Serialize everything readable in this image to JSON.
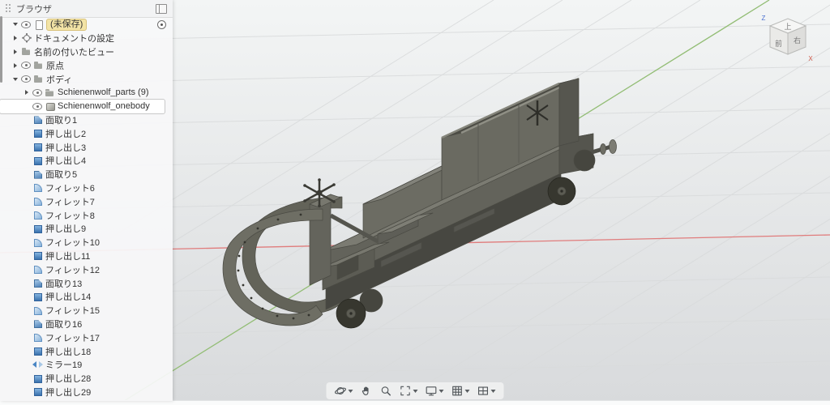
{
  "browser": {
    "title": "ブラウザ",
    "items": [
      {
        "label": "(未保存)",
        "icon": "document",
        "arrow": "open",
        "eye": true,
        "indent": 0,
        "pill": true,
        "radio": true
      },
      {
        "label": "ドキュメントの設定",
        "icon": "gear",
        "arrow": "closed",
        "eye": false,
        "indent": 0
      },
      {
        "label": "名前の付いたビュー",
        "icon": "folder",
        "arrow": "closed",
        "eye": false,
        "indent": 0
      },
      {
        "label": "原点",
        "icon": "folder",
        "arrow": "closed",
        "eye": true,
        "indent": 0
      },
      {
        "label": "ボディ",
        "icon": "folder",
        "arrow": "open",
        "eye": true,
        "indent": 0
      },
      {
        "label": "Schienenwolf_parts (9)",
        "icon": "folder",
        "arrow": "closed",
        "eye": true,
        "indent": 1
      },
      {
        "label": "Schienenwolf_onebody",
        "icon": "body",
        "arrow": "none",
        "eye": true,
        "indent": 1,
        "selected": true
      },
      {
        "label": "面取り1",
        "icon": "chamfer",
        "arrow": "none",
        "eye": false,
        "indent": 1
      },
      {
        "label": "押し出し2",
        "icon": "extrude",
        "arrow": "none",
        "eye": false,
        "indent": 1
      },
      {
        "label": "押し出し3",
        "icon": "extrude",
        "arrow": "none",
        "eye": false,
        "indent": 1
      },
      {
        "label": "押し出し4",
        "icon": "extrude",
        "arrow": "none",
        "eye": false,
        "indent": 1
      },
      {
        "label": "面取り5",
        "icon": "chamfer",
        "arrow": "none",
        "eye": false,
        "indent": 1
      },
      {
        "label": "フィレット6",
        "icon": "fillet",
        "arrow": "none",
        "eye": false,
        "indent": 1
      },
      {
        "label": "フィレット7",
        "icon": "fillet",
        "arrow": "none",
        "eye": false,
        "indent": 1
      },
      {
        "label": "フィレット8",
        "icon": "fillet",
        "arrow": "none",
        "eye": false,
        "indent": 1
      },
      {
        "label": "押し出し9",
        "icon": "extrude",
        "arrow": "none",
        "eye": false,
        "indent": 1
      },
      {
        "label": "フィレット10",
        "icon": "fillet",
        "arrow": "none",
        "eye": false,
        "indent": 1
      },
      {
        "label": "押し出し11",
        "icon": "extrude",
        "arrow": "none",
        "eye": false,
        "indent": 1
      },
      {
        "label": "フィレット12",
        "icon": "fillet",
        "arrow": "none",
        "eye": false,
        "indent": 1
      },
      {
        "label": "面取り13",
        "icon": "chamfer",
        "arrow": "none",
        "eye": false,
        "indent": 1
      },
      {
        "label": "押し出し14",
        "icon": "extrude",
        "arrow": "none",
        "eye": false,
        "indent": 1
      },
      {
        "label": "フィレット15",
        "icon": "fillet",
        "arrow": "none",
        "eye": false,
        "indent": 1
      },
      {
        "label": "面取り16",
        "icon": "chamfer",
        "arrow": "none",
        "eye": false,
        "indent": 1
      },
      {
        "label": "フィレット17",
        "icon": "fillet",
        "arrow": "none",
        "eye": false,
        "indent": 1
      },
      {
        "label": "押し出し18",
        "icon": "extrude",
        "arrow": "none",
        "eye": false,
        "indent": 1
      },
      {
        "label": "ミラー19",
        "icon": "mirror",
        "arrow": "none",
        "eye": false,
        "indent": 1
      },
      {
        "label": "押し出し28",
        "icon": "extrude",
        "arrow": "none",
        "eye": false,
        "indent": 1
      },
      {
        "label": "押し出し29",
        "icon": "extrude",
        "arrow": "none",
        "eye": false,
        "indent": 1
      }
    ]
  },
  "viewcube": {
    "top": "上",
    "front": "前",
    "right": "右",
    "axis_z": "Z",
    "axis_x": "X"
  },
  "navbar": {
    "items": [
      {
        "icon": "orbit-icon",
        "has_menu": true
      },
      {
        "icon": "pan-icon",
        "has_menu": false
      },
      {
        "icon": "zoom-icon",
        "has_menu": false
      },
      {
        "icon": "fit-icon",
        "has_menu": true
      },
      {
        "icon": "display-settings-icon",
        "has_menu": true
      },
      {
        "icon": "grid-snaps-icon",
        "has_menu": true
      },
      {
        "icon": "viewports-icon",
        "has_menu": true
      }
    ]
  },
  "colors": {
    "viewport_bg_top": "#f3f5f5",
    "viewport_bg_bottom": "#d8dadc",
    "axis_x_red": "#e07c7c",
    "axis_y_green": "#92bd74",
    "model_body_gray": "#68685f",
    "unsaved_pill_bg": "#f3e4a6",
    "selection_bg": "#ffffff",
    "feature_icon_blue": "#3a72ad"
  }
}
